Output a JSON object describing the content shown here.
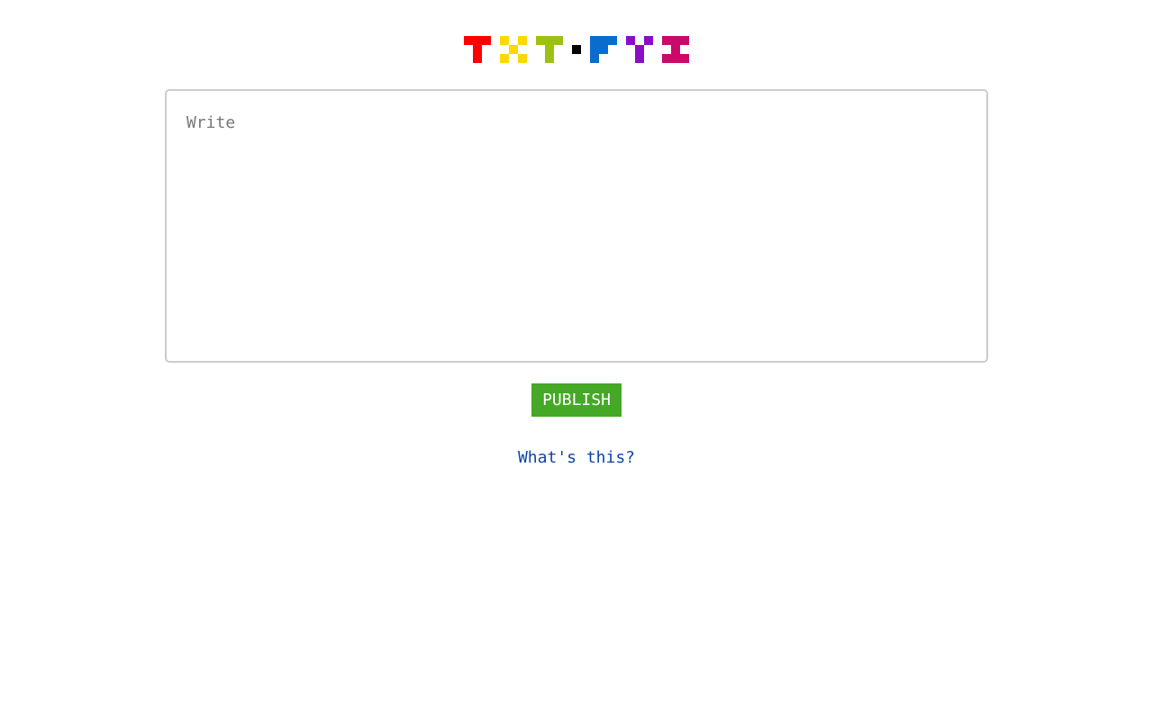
{
  "logo": {
    "alt": "TXT.FYI",
    "colors": {
      "t1": "#ff0000",
      "x": "#ffd800",
      "t2": "#9ec012",
      "dot": "#000000",
      "f": "#0a6ccc",
      "y": "#8a0ec8",
      "i": "#c80a6a"
    }
  },
  "editor": {
    "placeholder": "Write",
    "value": ""
  },
  "publish": {
    "label": "PUBLISH",
    "color": "#45a826"
  },
  "about": {
    "link_text": "What's this?",
    "color": "#0c46a5"
  }
}
